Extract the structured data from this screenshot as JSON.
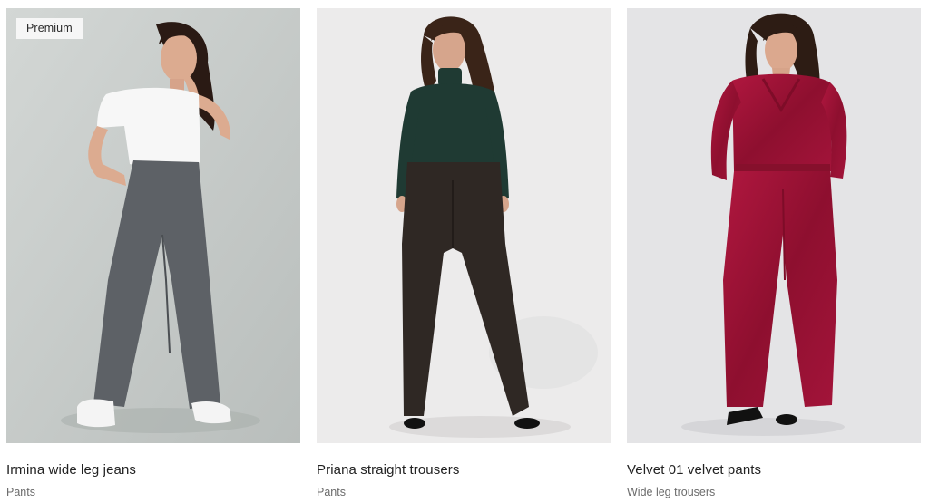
{
  "products": [
    {
      "badge": "Premium",
      "title": "Irmina wide leg jeans",
      "category": "Pants",
      "background": "#c7ccca"
    },
    {
      "badge": "",
      "title": "Priana straight trousers",
      "category": "Pants",
      "background": "#ecebeb"
    },
    {
      "badge": "",
      "title": "Velvet 01 velvet pants",
      "category": "Wide leg trousers",
      "background": "#e4e4e6"
    }
  ],
  "colors": {
    "denim": "#5d6166",
    "white_top": "#f7f7f7",
    "knit_green": "#1f3a33",
    "brown_trousers": "#2f2824",
    "velvet_red": "#9b1235",
    "skin": "#d9a98e",
    "hair": "#2a1a14"
  }
}
